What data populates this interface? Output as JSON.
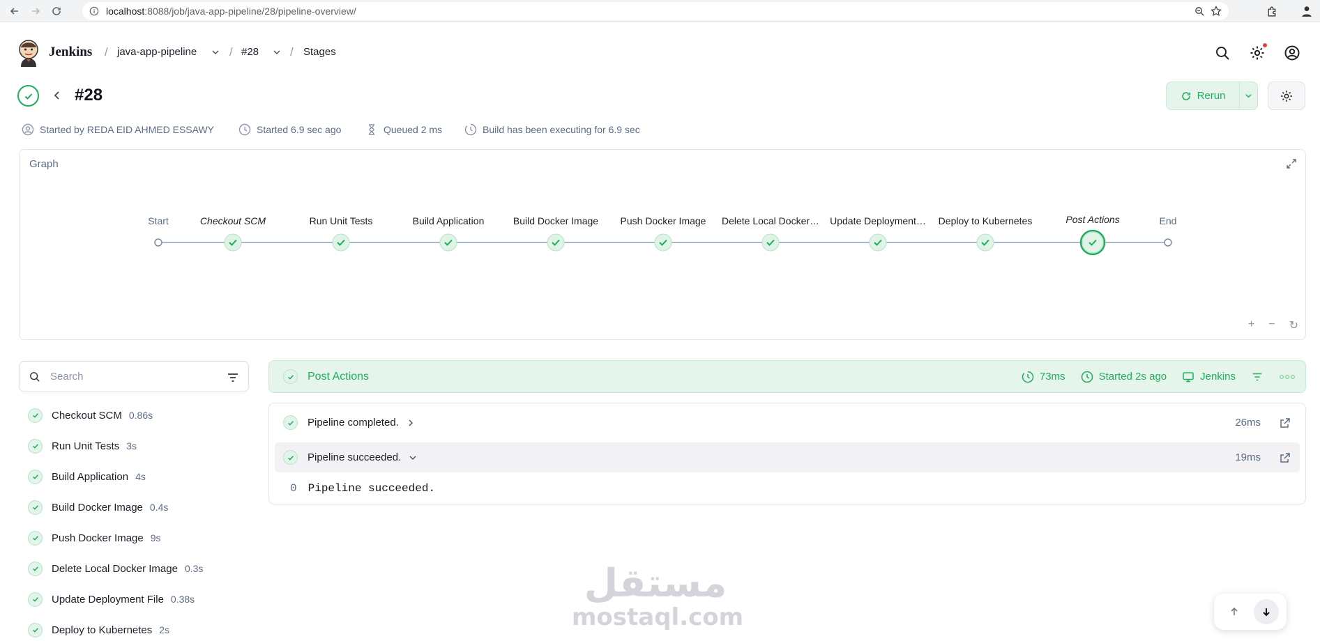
{
  "browser": {
    "url_host": "localhost",
    "url_path": ":8088/job/java-app-pipeline/28/pipeline-overview/"
  },
  "header": {
    "brand": "Jenkins",
    "breadcrumbs": [
      "java-app-pipeline",
      "#28",
      "Stages"
    ]
  },
  "build": {
    "title": "#28",
    "rerun_label": "Rerun",
    "status_color": "#1fae5b",
    "meta": {
      "started_by": "Started by REDA EID AHMED ESSAWY",
      "started": "Started 6.9 sec ago",
      "queued": "Queued 2 ms",
      "executing": "Build has been executing for 6.9 sec"
    }
  },
  "graph": {
    "label": "Graph",
    "nodes": [
      {
        "label": "Start",
        "kind": "terminal"
      },
      {
        "label": "Checkout SCM",
        "kind": "stage",
        "italic": true
      },
      {
        "label": "Run Unit Tests",
        "kind": "stage"
      },
      {
        "label": "Build Application",
        "kind": "stage"
      },
      {
        "label": "Build Docker Image",
        "kind": "stage"
      },
      {
        "label": "Push Docker Image",
        "kind": "stage"
      },
      {
        "label": "Delete Local Docker…",
        "kind": "stage"
      },
      {
        "label": "Update Deployment…",
        "kind": "stage"
      },
      {
        "label": "Deploy to Kubernetes",
        "kind": "stage"
      },
      {
        "label": "Post Actions",
        "kind": "stage",
        "italic": true,
        "selected": true
      },
      {
        "label": "End",
        "kind": "terminal"
      }
    ]
  },
  "sidebar": {
    "search_placeholder": "Search",
    "stages": [
      {
        "name": "Checkout SCM",
        "duration": "0.86s"
      },
      {
        "name": "Run Unit Tests",
        "duration": "3s"
      },
      {
        "name": "Build Application",
        "duration": "4s"
      },
      {
        "name": "Build Docker Image",
        "duration": "0.4s"
      },
      {
        "name": "Push Docker Image",
        "duration": "9s"
      },
      {
        "name": "Delete Local Docker Image",
        "duration": "0.3s"
      },
      {
        "name": "Update Deployment File",
        "duration": "0.38s"
      },
      {
        "name": "Deploy to Kubernetes",
        "duration": "2s"
      }
    ]
  },
  "detail": {
    "title": "Post Actions",
    "duration": "73ms",
    "started": "Started 2s ago",
    "agent": "Jenkins",
    "steps": [
      {
        "label": "Pipeline completed.",
        "time": "26ms",
        "expanded": false
      },
      {
        "label": "Pipeline succeeded.",
        "time": "19ms",
        "expanded": true
      }
    ],
    "log": {
      "line_no": "0",
      "text": "Pipeline succeeded."
    }
  },
  "watermark": {
    "arabic": "مستقل",
    "latin": "mostaql.com"
  }
}
